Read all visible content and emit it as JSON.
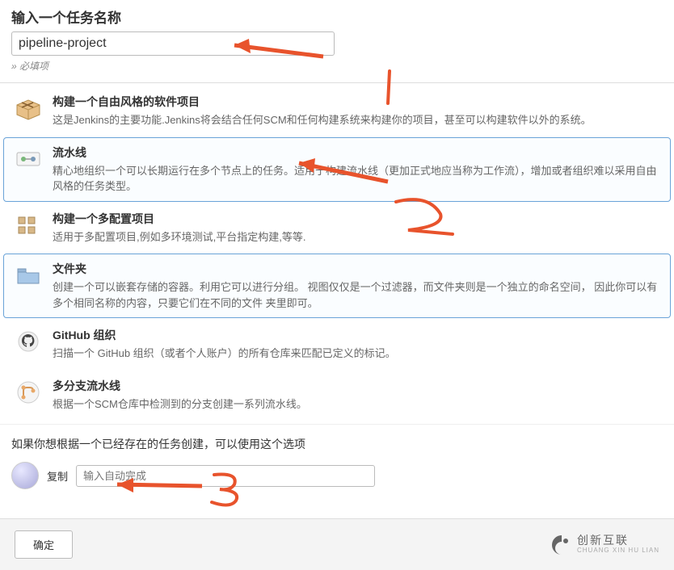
{
  "header": {
    "title": "输入一个任务名称",
    "name_value": "pipeline-project",
    "required_note": "» 必填项"
  },
  "items": [
    {
      "title": "构建一个自由风格的软件项目",
      "desc": "这是Jenkins的主要功能.Jenkins将会结合任何SCM和任何构建系统来构建你的项目，甚至可以构建软件以外的系统。",
      "icon": "box-icon",
      "selected": false
    },
    {
      "title": "流水线",
      "desc": "精心地组织一个可以长期运行在多个节点上的任务。适用于构建流水线（更加正式地应当称为工作流），增加或者组织难以采用自由风格的任务类型。",
      "icon": "pipeline-icon",
      "selected": true
    },
    {
      "title": "构建一个多配置项目",
      "desc": "适用于多配置项目,例如多环境测试,平台指定构建,等等.",
      "icon": "matrix-icon",
      "selected": false
    },
    {
      "title": "文件夹",
      "desc": "创建一个可以嵌套存储的容器。利用它可以进行分组。 视图仅仅是一个过滤器，而文件夹则是一个独立的命名空间， 因此你可以有多个相同名称的内容，只要它们在不同的文件 夹里即可。",
      "icon": "folder-icon",
      "selected": true
    },
    {
      "title": "GitHub 组织",
      "desc": "扫描一个 GitHub 组织（或者个人账户）的所有仓库来匹配已定义的标记。",
      "icon": "github-icon",
      "selected": false
    },
    {
      "title": "多分支流水线",
      "desc": "根据一个SCM仓库中检测到的分支创建一系列流水线。",
      "icon": "multibranch-icon",
      "selected": false
    }
  ],
  "copy_section": {
    "prompt": "如果你想根据一个已经存在的任务创建，可以使用这个选项",
    "label": "复制",
    "placeholder": "输入自动完成"
  },
  "footer": {
    "confirm": "确定",
    "brand_main": "创新互联",
    "brand_sub": "CHUANG XIN HU LIAN"
  }
}
